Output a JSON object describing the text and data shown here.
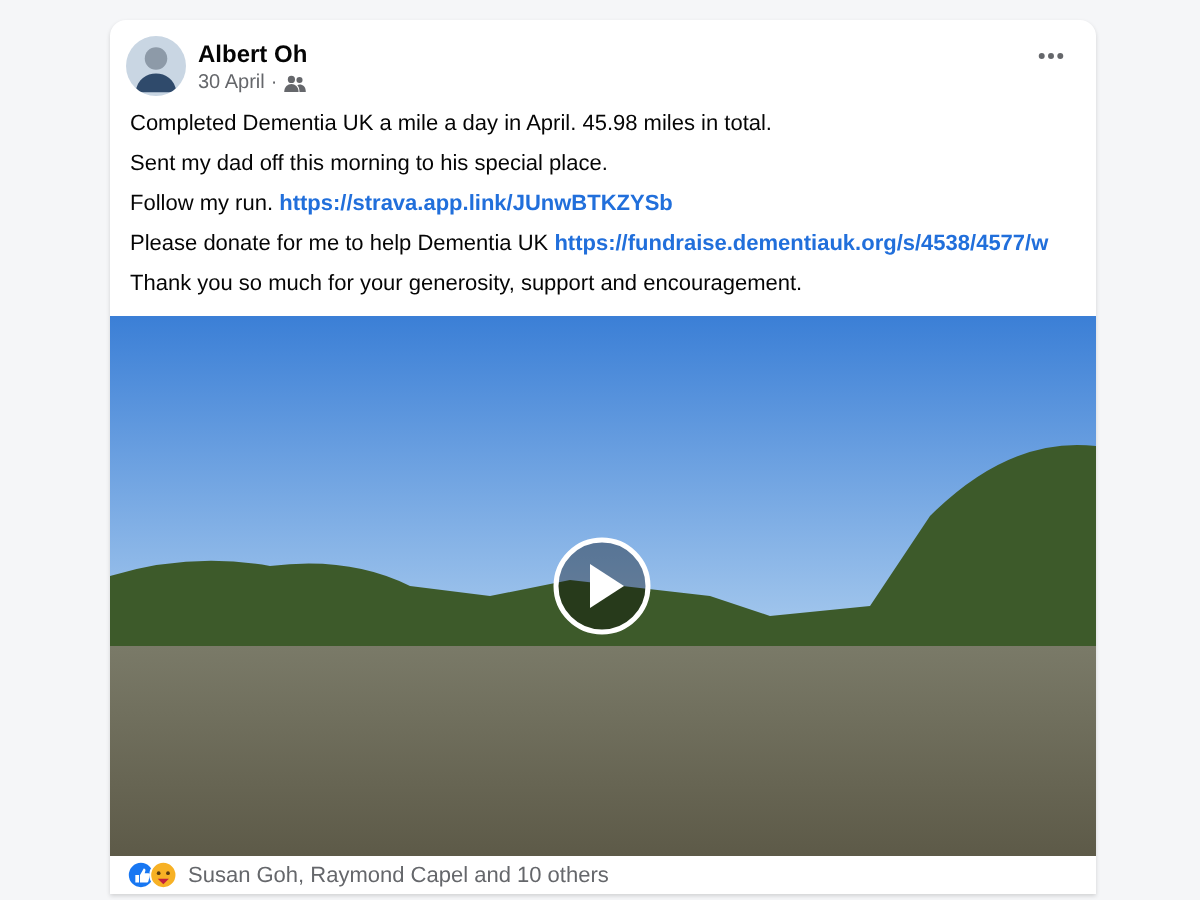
{
  "post": {
    "author": "Albert Oh",
    "date": "30 April",
    "separator": "·",
    "lines": [
      {
        "text": "Completed Dementia UK a mile a day in April. 45.98 miles in total."
      },
      {
        "text": "Sent my dad off this morning to his special place."
      },
      {
        "text": "Follow my run.",
        "link": "https://strava.app.link/JUnwBTKZYSb"
      },
      {
        "text": "Please donate for me to help Dementia UK",
        "link": "https://fundraise.dementiauk.org/s/4538/4577/w"
      },
      {
        "text": "Thank you so much for your generosity, support and encouragement."
      }
    ],
    "reactions": "Susan Goh, Raymond Capel and 10 others"
  }
}
